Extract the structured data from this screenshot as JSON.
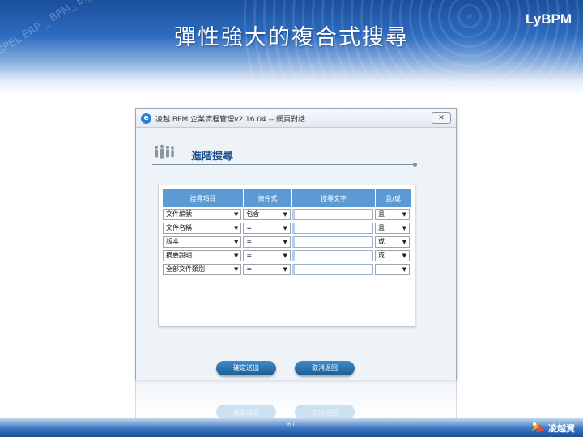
{
  "slide": {
    "title": "彈性強大的複合式搜尋",
    "brand": "LyBPM",
    "watermark": "BPEL ERP _ BPM_ BI_Flow_",
    "page_number": "61",
    "company": "凌越資訊"
  },
  "dialog": {
    "window_title": "凌越 BPM 企業流程管理v2.16.04 -- 網頁對話",
    "close_label": "✕",
    "section_title": "進階搜尋",
    "columns": [
      "搜尋項目",
      "條件式",
      "搜尋文字",
      "且/或"
    ],
    "rows": [
      {
        "item": "文件編號",
        "condition": "包含",
        "text": "",
        "logic": "且"
      },
      {
        "item": "文件名稱",
        "condition": "=",
        "text": "",
        "logic": "且"
      },
      {
        "item": "版本",
        "condition": "=",
        "text": "",
        "logic": "或"
      },
      {
        "item": "摘要說明",
        "condition": "=",
        "text": "",
        "logic": "或"
      },
      {
        "item": "全部文件類別",
        "condition": "=",
        "text": "",
        "logic": ""
      }
    ],
    "submit_label": "確定送出",
    "cancel_label": "取消返回"
  },
  "icons": {
    "people": "people-icon",
    "dropdown": "chevron-down-icon",
    "ie": "ie-icon"
  },
  "colors": {
    "header_blue": "#1a4f9c",
    "table_header": "#5b9ad2",
    "button": "#1b5e96"
  }
}
